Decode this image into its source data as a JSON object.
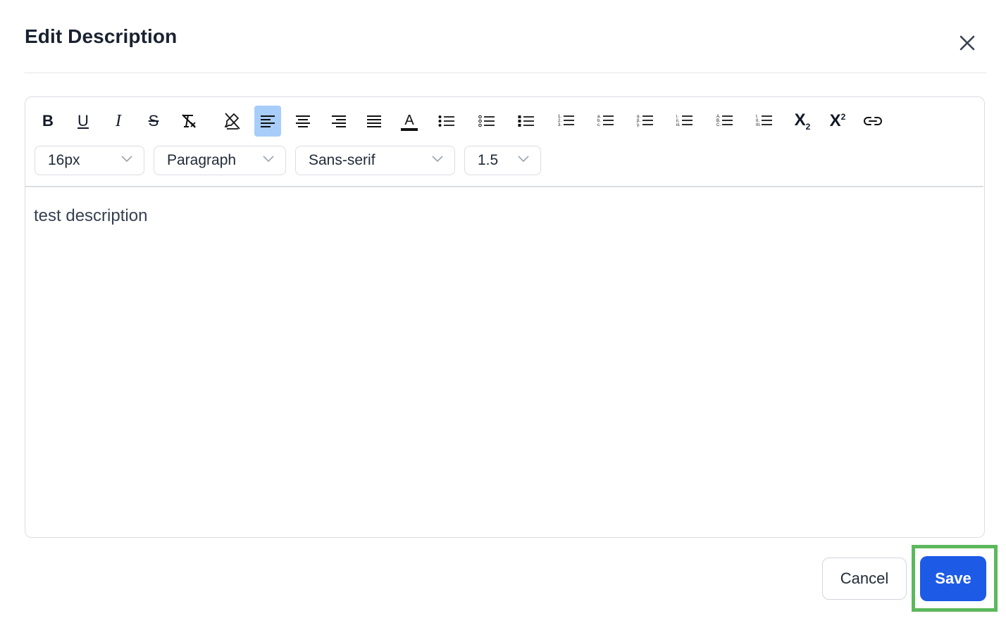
{
  "dialog": {
    "title": "Edit Description",
    "close_icon": "close-icon"
  },
  "toolbar": {
    "buttons": [
      {
        "name": "bold",
        "glyph": "B"
      },
      {
        "name": "underline",
        "glyph": "U"
      },
      {
        "name": "italic",
        "glyph": "I"
      },
      {
        "name": "strikethrough",
        "glyph": "S"
      },
      {
        "name": "clear-format",
        "glyph": "T"
      },
      {
        "name": "highlight-remove",
        "glyph": ""
      },
      {
        "name": "align-left",
        "glyph": "",
        "active": true
      },
      {
        "name": "align-center",
        "glyph": ""
      },
      {
        "name": "align-right",
        "glyph": ""
      },
      {
        "name": "align-justify",
        "glyph": ""
      },
      {
        "name": "font-color",
        "glyph": "A"
      },
      {
        "name": "bullet-list",
        "glyph": ""
      },
      {
        "name": "circle-list",
        "glyph": ""
      },
      {
        "name": "square-list",
        "glyph": ""
      },
      {
        "name": "numbered-list",
        "glyph": ""
      },
      {
        "name": "lower-alpha-list",
        "glyph": ""
      },
      {
        "name": "greek-list",
        "glyph": ""
      },
      {
        "name": "roman-list",
        "glyph": ""
      },
      {
        "name": "upper-alpha-list",
        "glyph": ""
      },
      {
        "name": "upper-roman-list",
        "glyph": ""
      },
      {
        "name": "subscript",
        "glyph": "X",
        "sub": "2"
      },
      {
        "name": "superscript",
        "glyph": "X",
        "sup": "2"
      },
      {
        "name": "link",
        "glyph": ""
      }
    ],
    "font_size": "16px",
    "block_type": "Paragraph",
    "font_family": "Sans-serif",
    "line_height": "1.5"
  },
  "editor": {
    "content": "test description"
  },
  "footer": {
    "cancel_label": "Cancel",
    "save_label": "Save"
  },
  "colors": {
    "accent": "#1d5ae6",
    "active_tool": "#a8cdfa",
    "highlight_box": "#5cb85c"
  }
}
